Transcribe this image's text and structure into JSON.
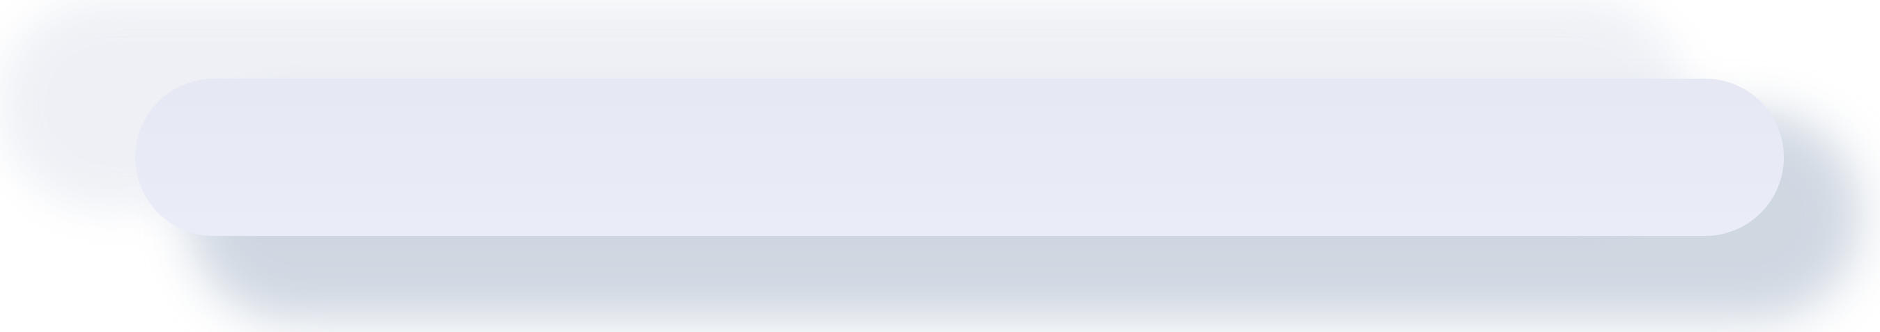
{
  "button": {
    "label": "",
    "fill_color": "#e8eaf6",
    "shadow_light_color": "#e9ecf3",
    "shadow_dark_color": "#a9b7ca"
  }
}
